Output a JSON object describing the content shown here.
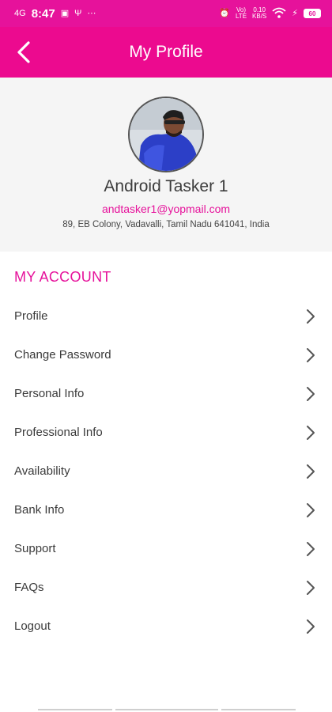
{
  "status_bar": {
    "time": "8:47",
    "left_icons": [
      "signal-4g-icon",
      "notification-app-icon",
      "usb-icon",
      "more-icon"
    ],
    "speed_top": "0.10",
    "speed_bottom": "KB/S",
    "volte_top": "Vo)",
    "volte_bottom": "LTE",
    "battery": "60"
  },
  "app_bar": {
    "title": "My Profile",
    "back_icon": "chevron-left-icon"
  },
  "profile": {
    "name": "Android Tasker 1",
    "email": "andtasker1@yopmail.com",
    "address": "89, EB Colony, Vadavalli, Tamil Nadu 641041, India"
  },
  "account": {
    "section_title": "MY ACCOUNT",
    "items": [
      {
        "label": "Profile"
      },
      {
        "label": "Change Password"
      },
      {
        "label": "Personal Info"
      },
      {
        "label": "Professional Info"
      },
      {
        "label": "Availability"
      },
      {
        "label": "Bank Info"
      },
      {
        "label": "Support"
      },
      {
        "label": "FAQs"
      },
      {
        "label": "Logout"
      }
    ]
  },
  "colors": {
    "accent": "#e6129b",
    "app_bar": "#ec0a8f",
    "header_bg": "#f5f5f5"
  }
}
